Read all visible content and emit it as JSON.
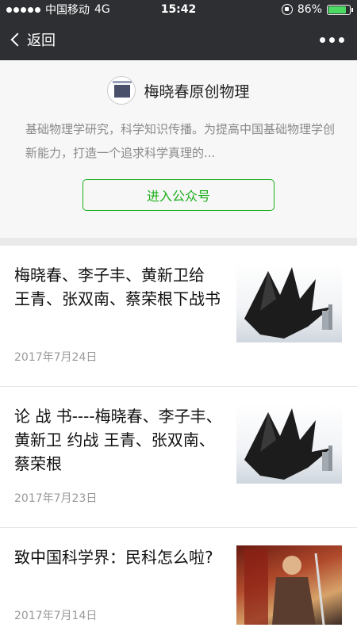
{
  "status_bar": {
    "carrier": "中国移动",
    "network": "4G",
    "time": "15:42",
    "battery": "86%",
    "battery_level": 0.86,
    "battery_color": "#4cd964"
  },
  "nav": {
    "back_label": "返回"
  },
  "account": {
    "name": "梅晓春原创物理",
    "description": "基础物理学研究，科学知识传播。为提高中国基础物理学创新能力，打造一个追求科学真理的...",
    "follow_label": "进入公众号",
    "accent_color": "#1aad19"
  },
  "articles": [
    {
      "title": "梅晓春、李子丰、黄新卫给 王青、张双南、蔡荣根下战书",
      "date": "2017年7月24日",
      "thumbnail": "dragon-image"
    },
    {
      "title": "论 战 书----梅晓春、李子丰、黄新卫 约战 王青、张双南、蔡荣根",
      "date": "2017年7月23日",
      "thumbnail": "dragon-image"
    },
    {
      "title": "致中国科学界：民科怎么啦?",
      "date": "2017年7月14日",
      "thumbnail": "knight-painting-image"
    }
  ]
}
